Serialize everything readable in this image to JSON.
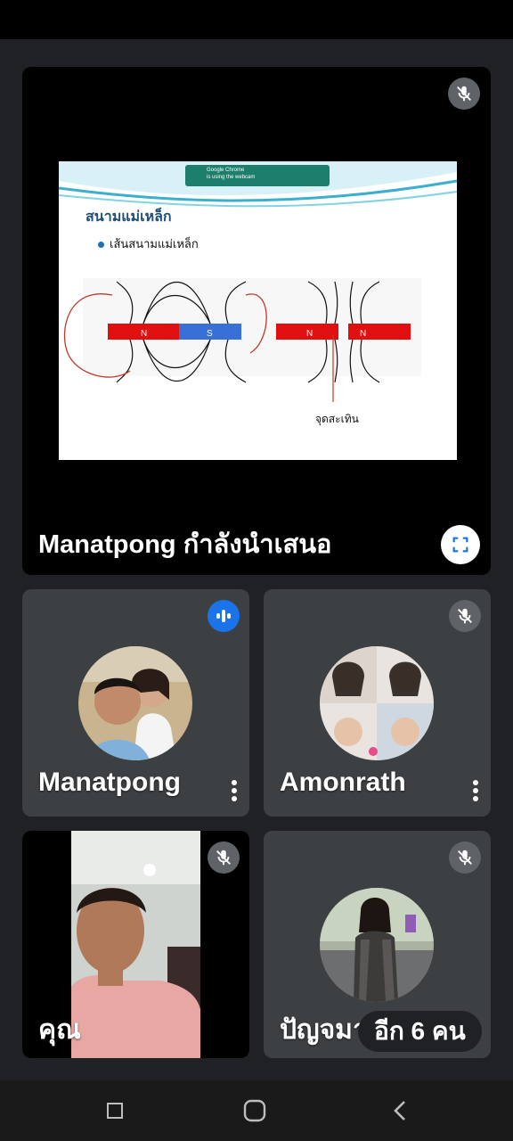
{
  "presenter": {
    "caption": "Manatpong กำลังนำเสนอ",
    "slide": {
      "title": "สนามแม่เหล็ก",
      "bullet": "เส้นสนามแม่เหล็ก",
      "annotation": "จุดสะเทิน",
      "notification_app": "Google Chrome",
      "notification_text": "is using the webcam"
    }
  },
  "participants": [
    {
      "name": "Manatpong",
      "status": "speaking"
    },
    {
      "name": "Amonrath",
      "status": "muted"
    },
    {
      "name": "คุณ",
      "status": "muted"
    },
    {
      "name": "ปัญจมา",
      "status": "muted"
    }
  ],
  "overflow": {
    "label": "อีก 6 คน"
  },
  "colors": {
    "accent": "#1a73e8",
    "tile": "#3c4043",
    "background": "#202124"
  }
}
